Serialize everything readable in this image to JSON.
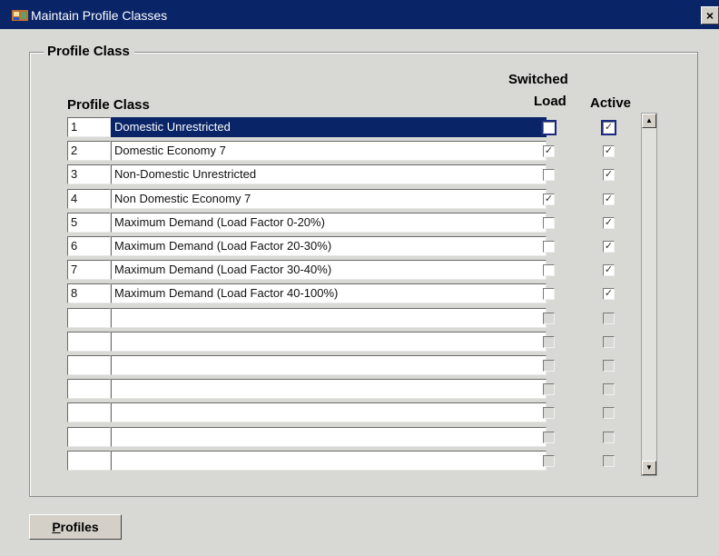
{
  "window": {
    "title": "Maintain Profile Classes",
    "close_glyph": "×"
  },
  "group": {
    "label": "Profile Class"
  },
  "headers": {
    "profile_class": "Profile Class",
    "switched_line1": "Switched",
    "switched_line2": "Load",
    "active": "Active"
  },
  "rows": [
    {
      "id": "1",
      "name": "Domestic Unrestricted",
      "switched_load": false,
      "active": true,
      "selected": true
    },
    {
      "id": "2",
      "name": "Domestic Economy 7",
      "switched_load": true,
      "active": true
    },
    {
      "id": "3",
      "name": "Non-Domestic Unrestricted",
      "switched_load": false,
      "active": true
    },
    {
      "id": "4",
      "name": "Non Domestic Economy 7",
      "switched_load": true,
      "active": true
    },
    {
      "id": "5",
      "name": "Maximum Demand (Load Factor 0-20%)",
      "switched_load": false,
      "active": true
    },
    {
      "id": "6",
      "name": "Maximum Demand (Load Factor 20-30%)",
      "switched_load": false,
      "active": true
    },
    {
      "id": "7",
      "name": "Maximum Demand (Load Factor 30-40%)",
      "switched_load": false,
      "active": true
    },
    {
      "id": "8",
      "name": "Maximum Demand (Load Factor 40-100%)",
      "switched_load": false,
      "active": true
    },
    {
      "id": "",
      "name": "",
      "switched_load": false,
      "active": false,
      "empty": true
    },
    {
      "id": "",
      "name": "",
      "switched_load": false,
      "active": false,
      "empty": true
    },
    {
      "id": "",
      "name": "",
      "switched_load": false,
      "active": false,
      "empty": true
    },
    {
      "id": "",
      "name": "",
      "switched_load": false,
      "active": false,
      "empty": true
    },
    {
      "id": "",
      "name": "",
      "switched_load": false,
      "active": false,
      "empty": true
    },
    {
      "id": "",
      "name": "",
      "switched_load": false,
      "active": false,
      "empty": true
    },
    {
      "id": "",
      "name": "",
      "switched_load": false,
      "active": false,
      "empty": true
    }
  ],
  "buttons": {
    "profiles_first": "P",
    "profiles_rest": "rofiles"
  },
  "scroll": {
    "up_glyph": "▲",
    "down_glyph": "▼"
  }
}
